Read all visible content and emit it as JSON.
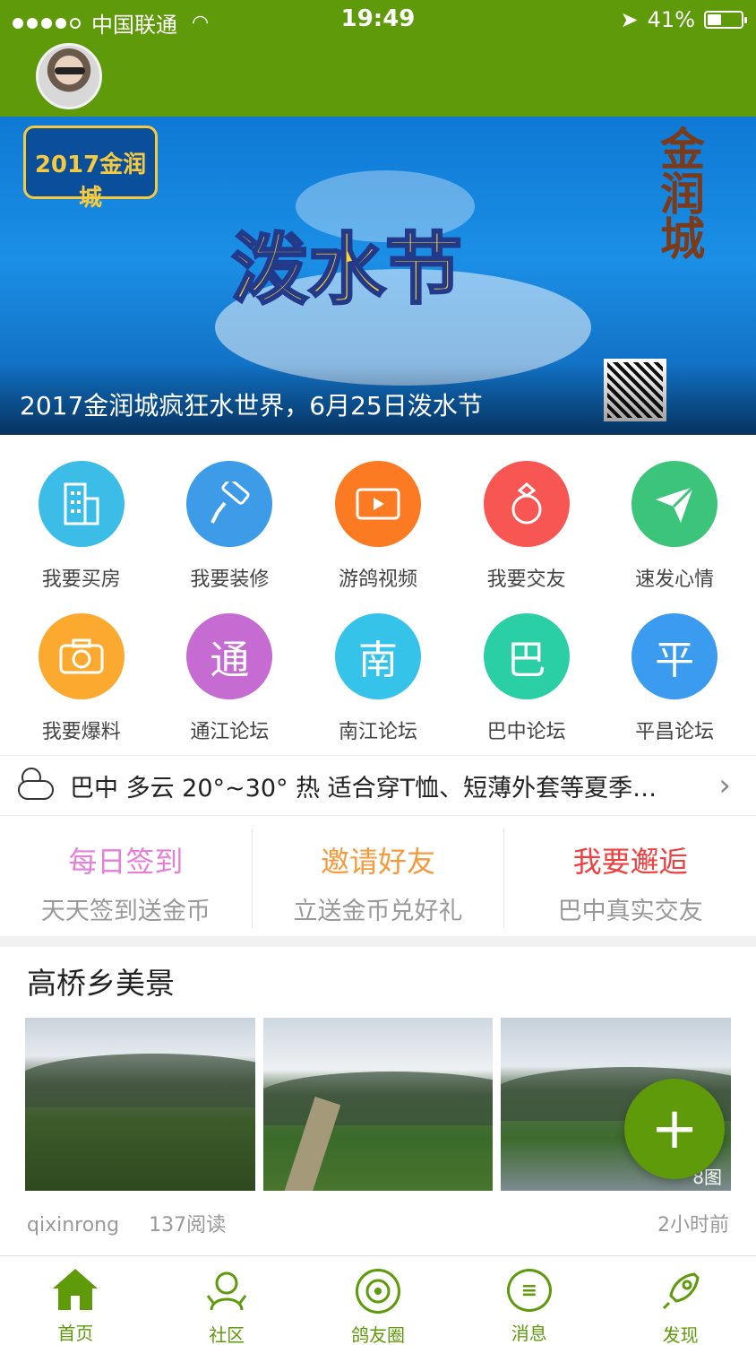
{
  "status_bar": {
    "carrier": "中国联通",
    "time": "19:49",
    "battery_text": "41%",
    "battery_level": 0.41
  },
  "banner": {
    "badge_text": "2017金润城",
    "headline": "泼水节",
    "caption": "2017金润城疯狂水世界，6月25日泼水节"
  },
  "grid": [
    {
      "label": "我要买房",
      "icon": "building-icon",
      "color": "#3bbde8"
    },
    {
      "label": "我要装修",
      "icon": "paint-roller-icon",
      "color": "#3e9be8"
    },
    {
      "label": "游鸽视频",
      "icon": "video-icon",
      "color": "#fb7a22"
    },
    {
      "label": "我要交友",
      "icon": "ring-icon",
      "color": "#f85652"
    },
    {
      "label": "速发心情",
      "icon": "paper-plane-icon",
      "color": "#3cc57a"
    },
    {
      "label": "我要爆料",
      "icon": "camera-icon",
      "color": "#fba92f"
    },
    {
      "label": "通江论坛",
      "icon_char": "通",
      "color": "#c56bd1"
    },
    {
      "label": "南江论坛",
      "icon_char": "南",
      "color": "#35c3ea"
    },
    {
      "label": "巴中论坛",
      "icon_char": "巴",
      "color": "#2bcfa6"
    },
    {
      "label": "平昌论坛",
      "icon_char": "平",
      "color": "#3a9bef"
    }
  ],
  "weather": {
    "text": "巴中 多云 20°~30° 热 适合穿T恤、短薄外套等夏季…"
  },
  "quick_actions": [
    {
      "title": "每日签到",
      "subtitle": "天天签到送金币",
      "color": "#e57fd9"
    },
    {
      "title": "邀请好友",
      "subtitle": "立送金币兑好礼",
      "color": "#f59a3d"
    },
    {
      "title": "我要邂逅",
      "subtitle": "巴中真实交友",
      "color": "#ef3f3f"
    }
  ],
  "article": {
    "title": "高桥乡美景",
    "photo_count": "8图",
    "author": "qixinrong",
    "reads": "137阅读",
    "time": "2小时前"
  },
  "fab": {
    "label": "+"
  },
  "tabs": [
    {
      "label": "首页",
      "icon": "home-icon"
    },
    {
      "label": "社区",
      "icon": "community-icon"
    },
    {
      "label": "鸽友圈",
      "icon": "pigeon-circle-icon"
    },
    {
      "label": "消息",
      "icon": "message-icon"
    },
    {
      "label": "发现",
      "icon": "rocket-icon"
    }
  ],
  "colors": {
    "brand_green": "#5e9a0a"
  }
}
